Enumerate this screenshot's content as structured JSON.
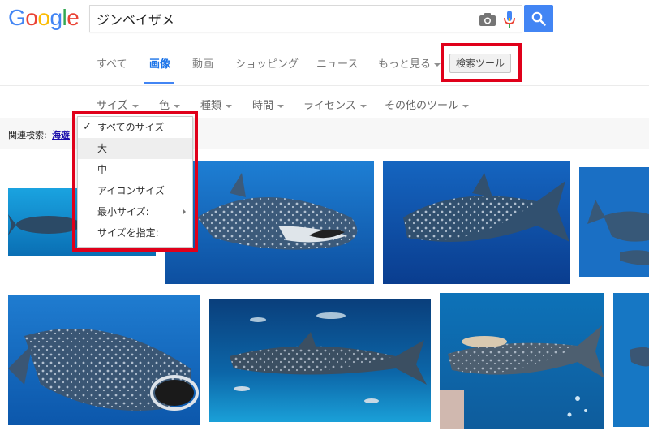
{
  "search": {
    "query": "ジンベイザメ"
  },
  "logo": {
    "letters": [
      "G",
      "o",
      "o",
      "g",
      "l",
      "e"
    ]
  },
  "tabs": [
    {
      "label": "すべて"
    },
    {
      "label": "画像"
    },
    {
      "label": "動画"
    },
    {
      "label": "ショッピング"
    },
    {
      "label": "ニュース"
    },
    {
      "label": "もっと見る"
    }
  ],
  "tools_button": {
    "label": "検索ツール"
  },
  "filters": [
    {
      "label": "サイズ"
    },
    {
      "label": "色"
    },
    {
      "label": "種類"
    },
    {
      "label": "時間"
    },
    {
      "label": "ライセンス"
    },
    {
      "label": "その他のツール"
    }
  ],
  "related": {
    "label": "関連検索:",
    "link": "海遊"
  },
  "size_menu": {
    "items": [
      {
        "label": "すべてのサイズ"
      },
      {
        "label": "大"
      },
      {
        "label": "中"
      },
      {
        "label": "アイコンサイズ"
      },
      {
        "label": "最小サイズ:"
      },
      {
        "label": "サイズを指定:"
      }
    ],
    "checkmark": "✓"
  },
  "colors": {
    "google_blue": "#4285f4",
    "google_red": "#ea4335",
    "google_yellow": "#fbbc05",
    "google_green": "#34a853",
    "highlight_red": "#e0001a",
    "active_tab": "#1a73e8"
  },
  "icons": [
    "camera-icon",
    "microphone-icon",
    "search-icon",
    "check-icon",
    "submenu-arrow-icon"
  ]
}
